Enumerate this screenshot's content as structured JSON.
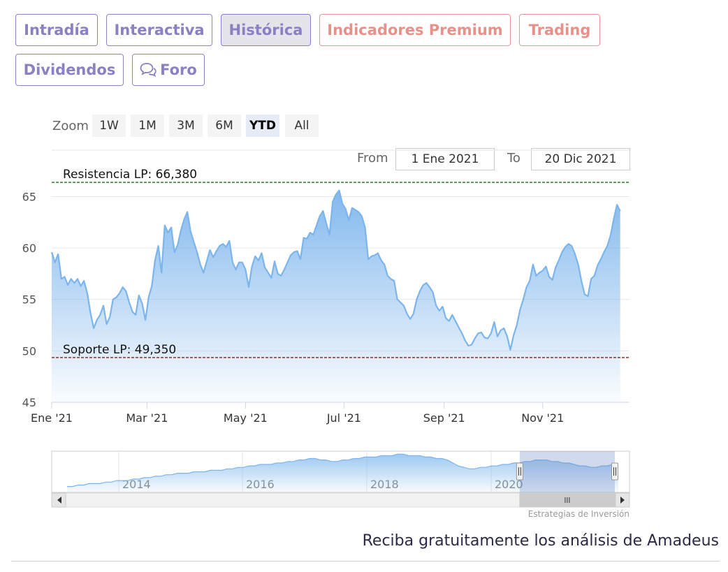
{
  "tabs": [
    {
      "label": "Intradía",
      "active": false,
      "premium": false
    },
    {
      "label": "Interactiva",
      "active": false,
      "premium": false
    },
    {
      "label": "Histórica",
      "active": true,
      "premium": false
    },
    {
      "label": "Indicadores Premium",
      "active": false,
      "premium": true
    },
    {
      "label": "Trading",
      "active": false,
      "premium": true
    },
    {
      "label": "Dividendos",
      "active": false,
      "premium": false
    },
    {
      "label": "Foro",
      "active": false,
      "premium": false,
      "icon": "chat-bubbles-icon"
    }
  ],
  "zoom": {
    "label": "Zoom",
    "buttons": [
      {
        "label": "1W",
        "selected": false
      },
      {
        "label": "1M",
        "selected": false
      },
      {
        "label": "3M",
        "selected": false
      },
      {
        "label": "6M",
        "selected": false
      },
      {
        "label": "YTD",
        "selected": true
      },
      {
        "label": "All",
        "selected": false
      }
    ]
  },
  "range": {
    "from_label": "From",
    "from_value": "1 Ene 2021",
    "to_label": "To",
    "to_value": "20 Dic 2021"
  },
  "chart_data": {
    "type": "area",
    "colors": {
      "line": "#7cb5ec",
      "fill_top": "#7cb5ec",
      "resistance": "#2e7d32",
      "support": "#8b1a1a"
    },
    "x_unit": "day of 2021",
    "x_range": [
      1,
      354
    ],
    "ylim": [
      45,
      67
    ],
    "y_ticks": [
      45,
      50,
      55,
      60,
      65
    ],
    "x_ticks": [
      {
        "label": "Ene '21",
        "day": 1
      },
      {
        "label": "Mar '21",
        "day": 60
      },
      {
        "label": "May '21",
        "day": 121
      },
      {
        "label": "Jul '21",
        "day": 182
      },
      {
        "label": "Sep '21",
        "day": 244
      },
      {
        "label": "Nov '21",
        "day": 305
      }
    ],
    "reference_lines": [
      {
        "label": "Resistencia LP: 66,380",
        "value": 66.38,
        "style": "dashed",
        "color": "#2e7d32"
      },
      {
        "label": "Soporte LP: 49,350",
        "value": 49.35,
        "style": "dashed",
        "color": "#8b1a1a"
      }
    ],
    "series": [
      {
        "points": [
          [
            1,
            59.6
          ],
          [
            3,
            58.6
          ],
          [
            5,
            59.4
          ],
          [
            7,
            57.0
          ],
          [
            9,
            57.2
          ],
          [
            11,
            56.4
          ],
          [
            13,
            57.0
          ],
          [
            15,
            56.6
          ],
          [
            17,
            57.0
          ],
          [
            19,
            56.3
          ],
          [
            21,
            56.8
          ],
          [
            23,
            55.6
          ],
          [
            25,
            53.7
          ],
          [
            27,
            52.2
          ],
          [
            29,
            53.0
          ],
          [
            31,
            53.5
          ],
          [
            33,
            54.4
          ],
          [
            35,
            52.6
          ],
          [
            37,
            53.3
          ],
          [
            39,
            55.0
          ],
          [
            41,
            55.2
          ],
          [
            43,
            55.6
          ],
          [
            45,
            56.2
          ],
          [
            47,
            55.8
          ],
          [
            49,
            54.7
          ],
          [
            51,
            53.8
          ],
          [
            53,
            53.5
          ],
          [
            55,
            55.4
          ],
          [
            57,
            54.6
          ],
          [
            59,
            53.0
          ],
          [
            61,
            55.2
          ],
          [
            63,
            56.3
          ],
          [
            65,
            58.8
          ],
          [
            67,
            60.2
          ],
          [
            69,
            57.6
          ],
          [
            71,
            62.2
          ],
          [
            73,
            61.5
          ],
          [
            75,
            62.0
          ],
          [
            77,
            59.6
          ],
          [
            79,
            60.3
          ],
          [
            81,
            61.7
          ],
          [
            83,
            62.8
          ],
          [
            85,
            63.5
          ],
          [
            87,
            61.6
          ],
          [
            89,
            60.6
          ],
          [
            91,
            59.6
          ],
          [
            93,
            58.4
          ],
          [
            95,
            57.6
          ],
          [
            97,
            58.7
          ],
          [
            99,
            59.8
          ],
          [
            101,
            59.1
          ],
          [
            103,
            59.7
          ],
          [
            105,
            60.2
          ],
          [
            107,
            60.4
          ],
          [
            109,
            60.1
          ],
          [
            111,
            60.7
          ],
          [
            113,
            58.6
          ],
          [
            115,
            57.9
          ],
          [
            117,
            58.6
          ],
          [
            119,
            58.6
          ],
          [
            121,
            57.9
          ],
          [
            123,
            56.2
          ],
          [
            125,
            58.2
          ],
          [
            127,
            59.2
          ],
          [
            129,
            58.8
          ],
          [
            131,
            59.5
          ],
          [
            133,
            58.1
          ],
          [
            135,
            57.6
          ],
          [
            137,
            57.1
          ],
          [
            139,
            58.7
          ],
          [
            141,
            57.5
          ],
          [
            143,
            57.3
          ],
          [
            145,
            57.9
          ],
          [
            147,
            58.6
          ],
          [
            149,
            59.3
          ],
          [
            151,
            59.6
          ],
          [
            153,
            59.7
          ],
          [
            155,
            58.9
          ],
          [
            157,
            61.0
          ],
          [
            159,
            60.9
          ],
          [
            161,
            61.5
          ],
          [
            163,
            61.3
          ],
          [
            165,
            62.2
          ],
          [
            167,
            63.1
          ],
          [
            169,
            63.6
          ],
          [
            171,
            62.4
          ],
          [
            173,
            61.3
          ],
          [
            175,
            64.5
          ],
          [
            177,
            65.2
          ],
          [
            179,
            65.6
          ],
          [
            181,
            64.3
          ],
          [
            183,
            63.8
          ],
          [
            185,
            62.7
          ],
          [
            187,
            63.9
          ],
          [
            189,
            63.7
          ],
          [
            191,
            63.5
          ],
          [
            193,
            63.1
          ],
          [
            195,
            62.0
          ],
          [
            197,
            58.9
          ],
          [
            199,
            59.2
          ],
          [
            201,
            59.3
          ],
          [
            203,
            59.5
          ],
          [
            205,
            58.8
          ],
          [
            207,
            58.4
          ],
          [
            209,
            57.3
          ],
          [
            211,
            57.0
          ],
          [
            213,
            56.8
          ],
          [
            215,
            55.0
          ],
          [
            217,
            54.7
          ],
          [
            219,
            54.4
          ],
          [
            221,
            53.6
          ],
          [
            223,
            53.1
          ],
          [
            225,
            53.6
          ],
          [
            227,
            55.0
          ],
          [
            229,
            55.8
          ],
          [
            231,
            56.4
          ],
          [
            233,
            56.6
          ],
          [
            235,
            56.2
          ],
          [
            237,
            55.7
          ],
          [
            239,
            54.4
          ],
          [
            241,
            53.9
          ],
          [
            243,
            54.3
          ],
          [
            245,
            53.2
          ],
          [
            247,
            52.9
          ],
          [
            249,
            53.5
          ],
          [
            251,
            52.9
          ],
          [
            253,
            52.3
          ],
          [
            255,
            51.7
          ],
          [
            257,
            51.0
          ],
          [
            259,
            50.5
          ],
          [
            261,
            50.6
          ],
          [
            263,
            51.2
          ],
          [
            265,
            51.7
          ],
          [
            267,
            51.8
          ],
          [
            269,
            51.3
          ],
          [
            271,
            51.2
          ],
          [
            273,
            51.7
          ],
          [
            275,
            52.8
          ],
          [
            277,
            51.4
          ],
          [
            279,
            52.0
          ],
          [
            281,
            52.2
          ],
          [
            283,
            51.4
          ],
          [
            285,
            50.1
          ],
          [
            287,
            51.5
          ],
          [
            289,
            52.5
          ],
          [
            291,
            54.0
          ],
          [
            293,
            55.0
          ],
          [
            295,
            56.2
          ],
          [
            297,
            56.8
          ],
          [
            299,
            58.4
          ],
          [
            301,
            57.3
          ],
          [
            303,
            57.6
          ],
          [
            305,
            57.8
          ],
          [
            307,
            58.2
          ],
          [
            309,
            57.2
          ],
          [
            311,
            56.9
          ],
          [
            313,
            58.1
          ],
          [
            315,
            58.8
          ],
          [
            317,
            59.6
          ],
          [
            319,
            60.1
          ],
          [
            321,
            60.4
          ],
          [
            323,
            60.2
          ],
          [
            325,
            59.4
          ],
          [
            327,
            58.4
          ],
          [
            329,
            56.8
          ],
          [
            331,
            55.5
          ],
          [
            333,
            55.3
          ],
          [
            335,
            57.0
          ],
          [
            337,
            57.3
          ],
          [
            339,
            58.3
          ],
          [
            341,
            58.9
          ],
          [
            343,
            59.6
          ],
          [
            345,
            60.2
          ],
          [
            347,
            61.2
          ],
          [
            349,
            62.8
          ],
          [
            351,
            64.2
          ],
          [
            353,
            63.6
          ]
        ]
      }
    ]
  },
  "navigator": {
    "labels": [
      "2014",
      "2016",
      "2018",
      "2020"
    ],
    "values": [
      42,
      42,
      43,
      43,
      44,
      44,
      44,
      45,
      45,
      46,
      46,
      46,
      47,
      47,
      48,
      48,
      49,
      49,
      50,
      50,
      51,
      51,
      51,
      52,
      52,
      52,
      53,
      53,
      53,
      54,
      54,
      55,
      55,
      56,
      56,
      57,
      57,
      57,
      58,
      58,
      59,
      59,
      60,
      60,
      61,
      61,
      60,
      60,
      59,
      59,
      60,
      60,
      61,
      61,
      62,
      62,
      62,
      63,
      63,
      63,
      64,
      64,
      63,
      63,
      63,
      62,
      62,
      61,
      61,
      60,
      58,
      56,
      55,
      54,
      54,
      55,
      55,
      56,
      56,
      57,
      57,
      58,
      58,
      59,
      59,
      60,
      60,
      60,
      59,
      59,
      58,
      58,
      57,
      56,
      56,
      55,
      55,
      56,
      56,
      57,
      57
    ],
    "selected_from": 0.81
  },
  "credits": "Estrategias de Inversión",
  "cta": "Reciba gratuitamente los análisis de Amadeus"
}
